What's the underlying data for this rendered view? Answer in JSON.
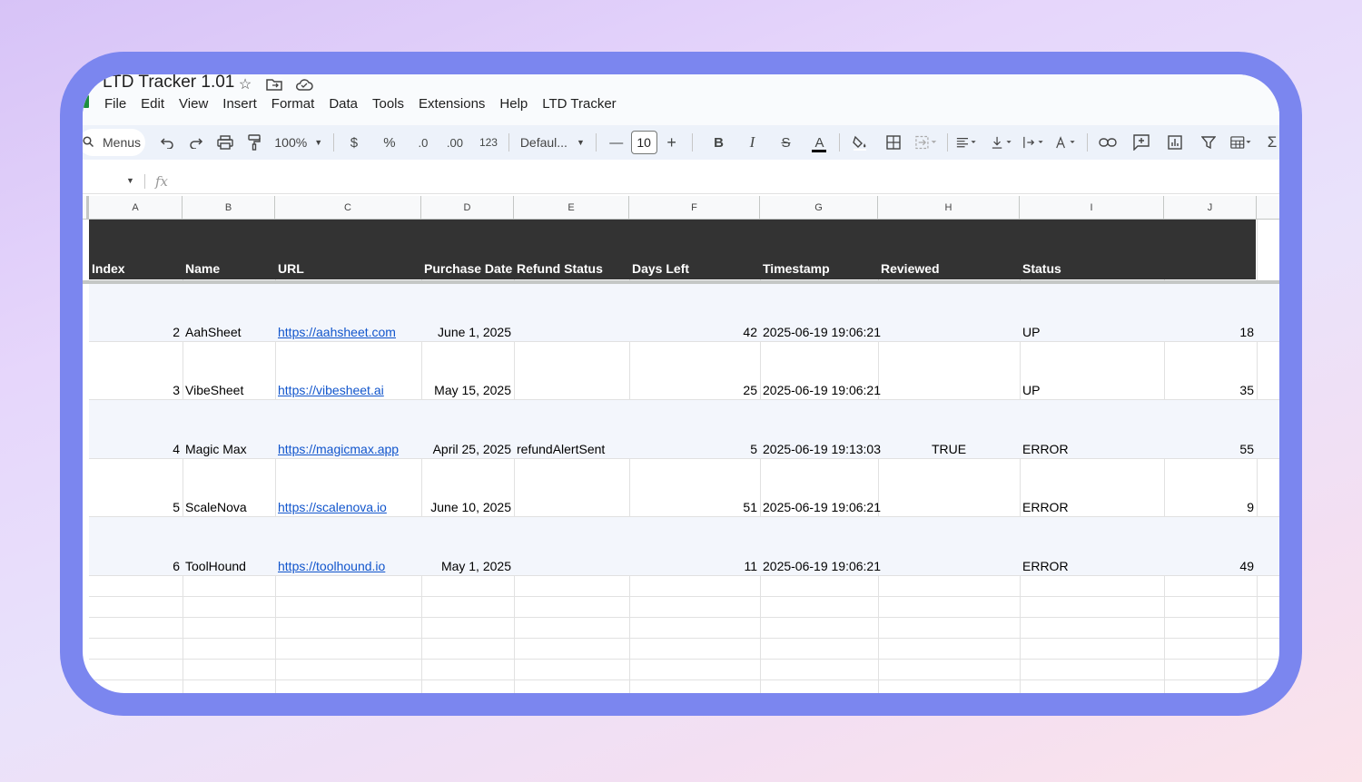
{
  "doc": {
    "title": "LTD Tracker 1.01"
  },
  "menu": [
    "File",
    "Edit",
    "View",
    "Insert",
    "Format",
    "Data",
    "Tools",
    "Extensions",
    "Help",
    "LTD Tracker"
  ],
  "toolbar": {
    "search_label": "Menus",
    "zoom": "100%",
    "currency": "$",
    "percent": "%",
    "dec_decrease": ".0",
    "dec_increase": ".00",
    "number_format": "123",
    "font": "Defaul...",
    "font_size": "10",
    "bold": "B",
    "italic": "I",
    "strike": "S",
    "text_color": "A",
    "sum": "Σ"
  },
  "formula_bar": {
    "fx": "fx"
  },
  "columns": [
    "A",
    "B",
    "C",
    "D",
    "E",
    "F",
    "G",
    "H",
    "I",
    "J"
  ],
  "headers": [
    "Index",
    "Name",
    "URL",
    "Purchase Date",
    "Refund Status",
    "Days Left",
    "Timestamp",
    "Reviewed",
    "Status",
    ""
  ],
  "rows": [
    {
      "index": "2",
      "name": "AahSheet",
      "url": "https://aahsheet.com",
      "purchase_date": "June 1, 2025",
      "refund_status": "",
      "days_left": "42",
      "timestamp": "2025-06-19 19:06:21",
      "reviewed": "",
      "status": "UP",
      "j": "18"
    },
    {
      "index": "3",
      "name": "VibeSheet",
      "url": "https://vibesheet.ai",
      "purchase_date": "May 15, 2025",
      "refund_status": "",
      "days_left": "25",
      "timestamp": "2025-06-19 19:06:21",
      "reviewed": "",
      "status": "UP",
      "j": "35"
    },
    {
      "index": "4",
      "name": "Magic Max",
      "url": "https://magicmax.app",
      "purchase_date": "April 25, 2025",
      "refund_status": "refundAlertSent",
      "days_left": "5",
      "timestamp": "2025-06-19 19:13:03",
      "reviewed": "TRUE",
      "status": "ERROR",
      "j": "55"
    },
    {
      "index": "5",
      "name": "ScaleNova",
      "url": "https://scalenova.io",
      "purchase_date": "June 10, 2025",
      "refund_status": "",
      "days_left": "51",
      "timestamp": "2025-06-19 19:06:21",
      "reviewed": "",
      "status": "ERROR",
      "j": "9"
    },
    {
      "index": "6",
      "name": "ToolHound",
      "url": "https://toolhound.io",
      "purchase_date": "May 1, 2025",
      "refund_status": "",
      "days_left": "11",
      "timestamp": "2025-06-19 19:06:21",
      "reviewed": "",
      "status": "ERROR",
      "j": "49"
    }
  ],
  "colors": {
    "frame": "#7b86ef",
    "header_bg": "#333333",
    "band": "#f3f6fc",
    "link": "#1155cc"
  },
  "icons": [
    "star-icon",
    "move-to-folder-icon",
    "cloud-status-icon",
    "search-icon",
    "undo-icon",
    "redo-icon",
    "print-icon",
    "paint-format-icon",
    "fill-color-icon",
    "borders-icon",
    "merge-cells-icon",
    "align-left-icon",
    "vertical-align-icon",
    "text-wrap-icon",
    "text-rotation-icon",
    "link-icon",
    "comment-icon",
    "chart-icon",
    "filter-icon",
    "table-icon",
    "functions-icon"
  ]
}
